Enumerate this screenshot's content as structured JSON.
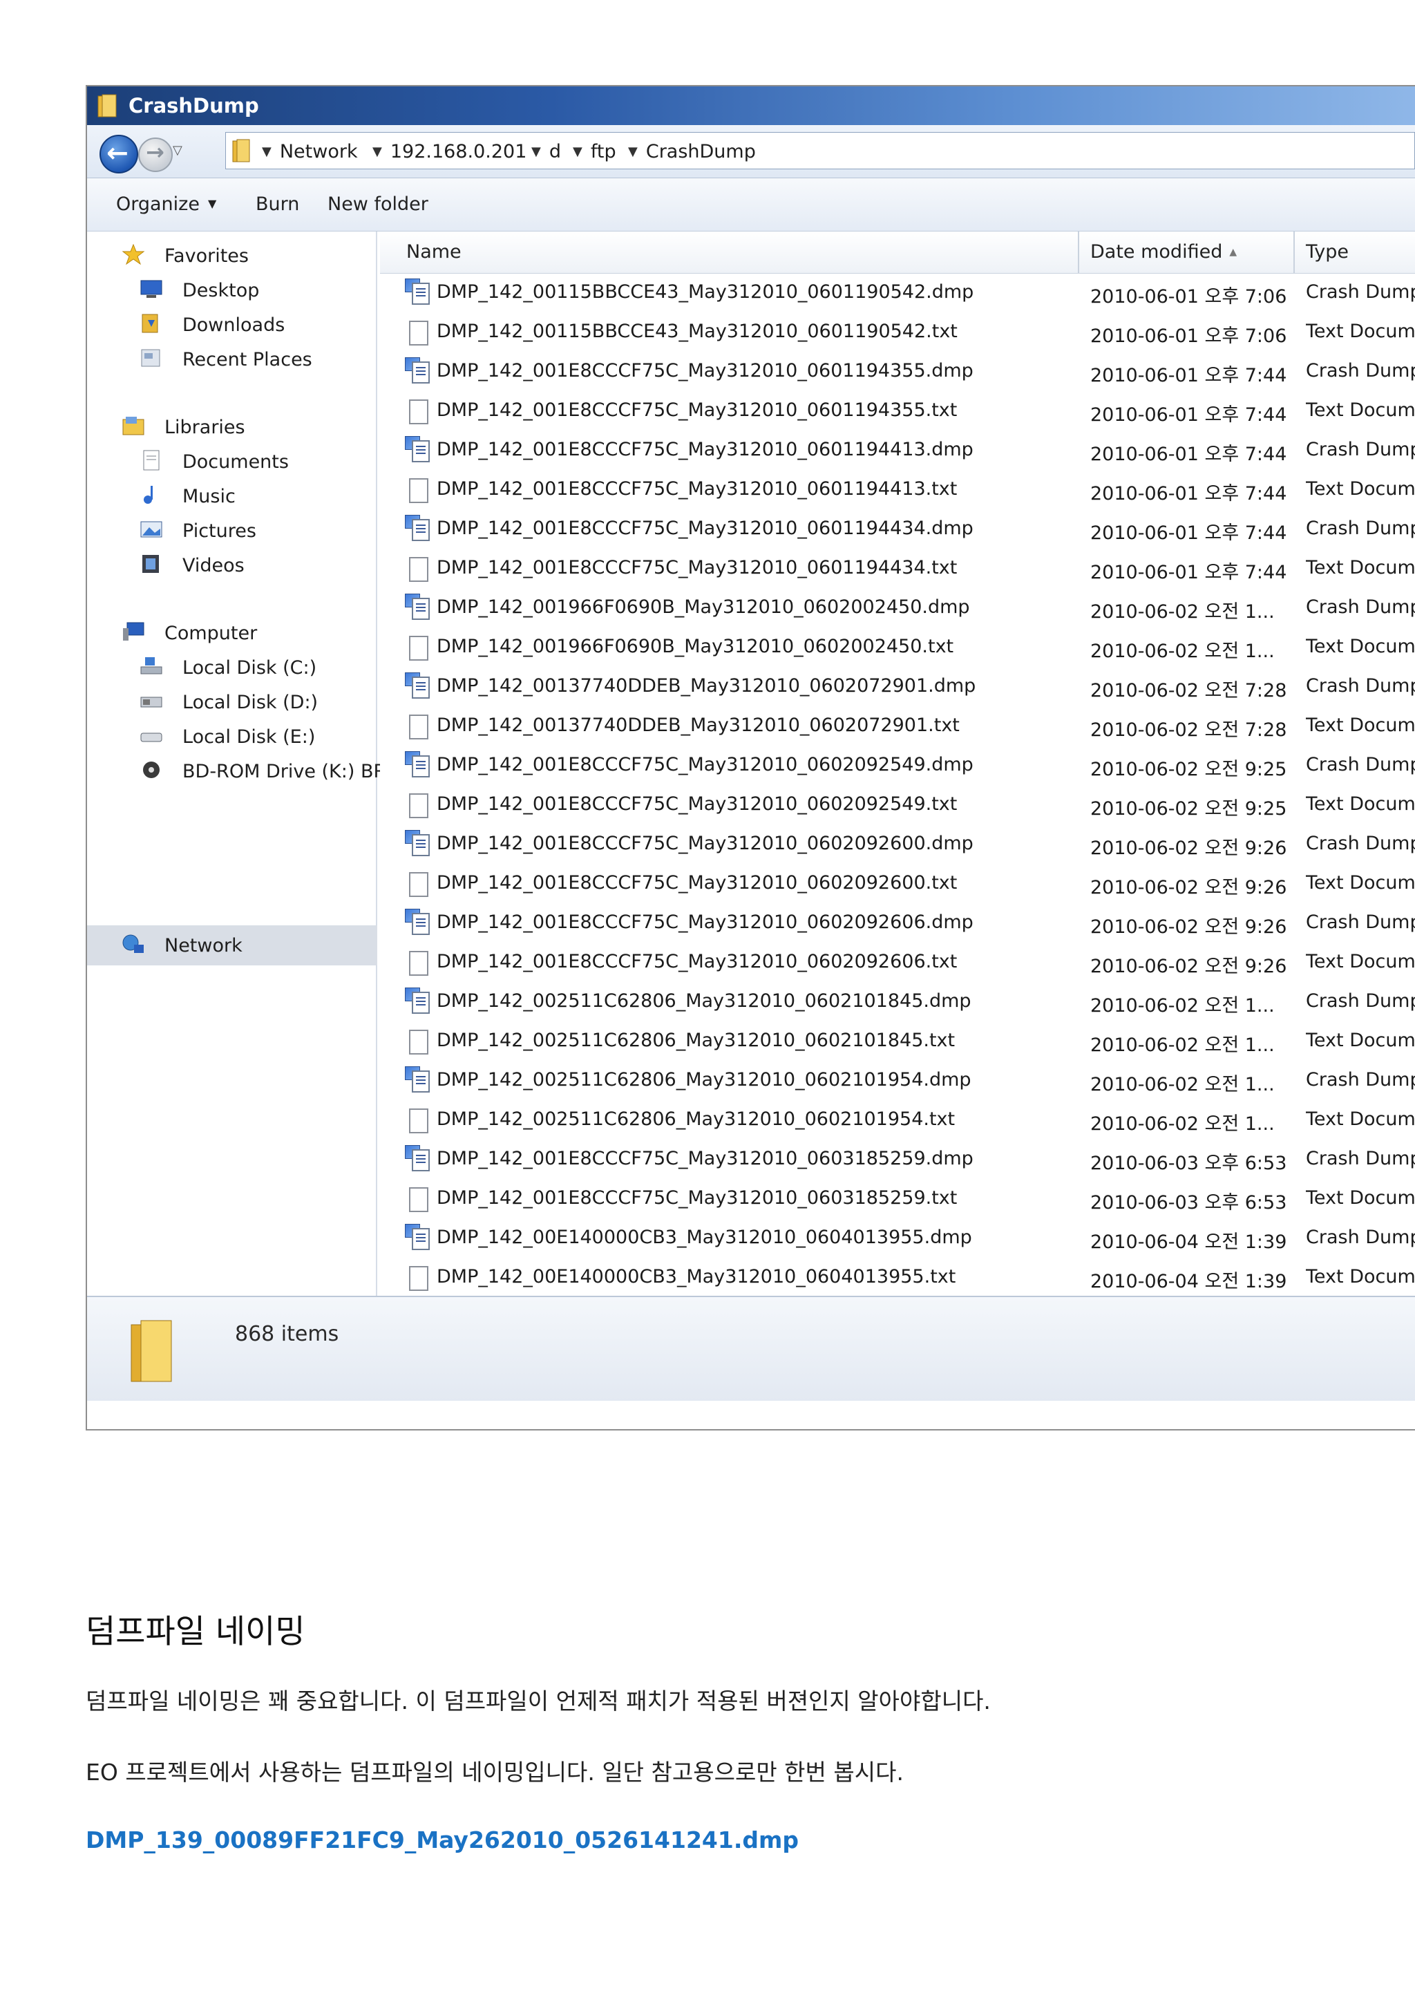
{
  "window": {
    "title": "CrashDump",
    "breadcrumbs": [
      "Network",
      "192.168.0.201",
      "d",
      "ftp",
      "CrashDump"
    ]
  },
  "toolbar": {
    "organize": "Organize",
    "burn": "Burn",
    "new_folder": "New folder"
  },
  "nav": {
    "favorites": "Favorites",
    "desktop": "Desktop",
    "downloads": "Downloads",
    "recent_places": "Recent Places",
    "libraries": "Libraries",
    "documents": "Documents",
    "music": "Music",
    "pictures": "Pictures",
    "videos": "Videos",
    "computer": "Computer",
    "local_c": "Local Disk (C:)",
    "local_d": "Local Disk (D:)",
    "local_e": "Local Disk (E:)",
    "bdrom": "BD-ROM Drive (K:) BR",
    "network": "Network"
  },
  "columns": {
    "name": "Name",
    "date": "Date modified",
    "type": "Type"
  },
  "files": [
    {
      "name": "DMP_142_00115BBCCE43_May312010_0601190542.dmp",
      "date": "2010-06-01 오후 7:06",
      "type": "Crash Dump I",
      "kind": "dmp"
    },
    {
      "name": "DMP_142_00115BBCCE43_May312010_0601190542.txt",
      "date": "2010-06-01 오후 7:06",
      "type": "Text Docume",
      "kind": "txt"
    },
    {
      "name": "DMP_142_001E8CCCF75C_May312010_0601194355.dmp",
      "date": "2010-06-01 오후 7:44",
      "type": "Crash Dump I",
      "kind": "dmp"
    },
    {
      "name": "DMP_142_001E8CCCF75C_May312010_0601194355.txt",
      "date": "2010-06-01 오후 7:44",
      "type": "Text Docume",
      "kind": "txt"
    },
    {
      "name": "DMP_142_001E8CCCF75C_May312010_0601194413.dmp",
      "date": "2010-06-01 오후 7:44",
      "type": "Crash Dump I",
      "kind": "dmp"
    },
    {
      "name": "DMP_142_001E8CCCF75C_May312010_0601194413.txt",
      "date": "2010-06-01 오후 7:44",
      "type": "Text Docume",
      "kind": "txt"
    },
    {
      "name": "DMP_142_001E8CCCF75C_May312010_0601194434.dmp",
      "date": "2010-06-01 오후 7:44",
      "type": "Crash Dump I",
      "kind": "dmp"
    },
    {
      "name": "DMP_142_001E8CCCF75C_May312010_0601194434.txt",
      "date": "2010-06-01 오후 7:44",
      "type": "Text Docume",
      "kind": "txt"
    },
    {
      "name": "DMP_142_001966F0690B_May312010_0602002450.dmp",
      "date": "2010-06-02 오전 1...",
      "type": "Crash Dump I",
      "kind": "dmp"
    },
    {
      "name": "DMP_142_001966F0690B_May312010_0602002450.txt",
      "date": "2010-06-02 오전 1...",
      "type": "Text Docume",
      "kind": "txt"
    },
    {
      "name": "DMP_142_00137740DDEB_May312010_0602072901.dmp",
      "date": "2010-06-02 오전 7:28",
      "type": "Crash Dump I",
      "kind": "dmp"
    },
    {
      "name": "DMP_142_00137740DDEB_May312010_0602072901.txt",
      "date": "2010-06-02 오전 7:28",
      "type": "Text Docume",
      "kind": "txt"
    },
    {
      "name": "DMP_142_001E8CCCF75C_May312010_0602092549.dmp",
      "date": "2010-06-02 오전 9:25",
      "type": "Crash Dump I",
      "kind": "dmp"
    },
    {
      "name": "DMP_142_001E8CCCF75C_May312010_0602092549.txt",
      "date": "2010-06-02 오전 9:25",
      "type": "Text Docume",
      "kind": "txt"
    },
    {
      "name": "DMP_142_001E8CCCF75C_May312010_0602092600.dmp",
      "date": "2010-06-02 오전 9:26",
      "type": "Crash Dump I",
      "kind": "dmp"
    },
    {
      "name": "DMP_142_001E8CCCF75C_May312010_0602092600.txt",
      "date": "2010-06-02 오전 9:26",
      "type": "Text Docume",
      "kind": "txt"
    },
    {
      "name": "DMP_142_001E8CCCF75C_May312010_0602092606.dmp",
      "date": "2010-06-02 오전 9:26",
      "type": "Crash Dump I",
      "kind": "dmp"
    },
    {
      "name": "DMP_142_001E8CCCF75C_May312010_0602092606.txt",
      "date": "2010-06-02 오전 9:26",
      "type": "Text Docume",
      "kind": "txt"
    },
    {
      "name": "DMP_142_002511C62806_May312010_0602101845.dmp",
      "date": "2010-06-02 오전 1...",
      "type": "Crash Dump I",
      "kind": "dmp"
    },
    {
      "name": "DMP_142_002511C62806_May312010_0602101845.txt",
      "date": "2010-06-02 오전 1...",
      "type": "Text Docume",
      "kind": "txt"
    },
    {
      "name": "DMP_142_002511C62806_May312010_0602101954.dmp",
      "date": "2010-06-02 오전 1...",
      "type": "Crash Dump I",
      "kind": "dmp"
    },
    {
      "name": "DMP_142_002511C62806_May312010_0602101954.txt",
      "date": "2010-06-02 오전 1...",
      "type": "Text Docume",
      "kind": "txt"
    },
    {
      "name": "DMP_142_001E8CCCF75C_May312010_0603185259.dmp",
      "date": "2010-06-03 오후 6:53",
      "type": "Crash Dump I",
      "kind": "dmp"
    },
    {
      "name": "DMP_142_001E8CCCF75C_May312010_0603185259.txt",
      "date": "2010-06-03 오후 6:53",
      "type": "Text Docume",
      "kind": "txt"
    },
    {
      "name": "DMP_142_00E140000CB3_May312010_0604013955.dmp",
      "date": "2010-06-04 오전 1:39",
      "type": "Crash Dump I",
      "kind": "dmp"
    },
    {
      "name": "DMP_142_00E140000CB3_May312010_0604013955.txt",
      "date": "2010-06-04 오전 1:39",
      "type": "Text Docume",
      "kind": "txt"
    }
  ],
  "status": {
    "item_count": "868 items"
  },
  "article": {
    "heading": "덤프파일 네이밍",
    "para1": "덤프파일 네이밍은 꽤 중요합니다. 이 덤프파일이 언제적 패치가 적용된 버젼인지 알아야합니다.",
    "para2": "EO 프로젝트에서 사용하는 덤프파일의 네이밍입니다. 일단 참고용으로만 한번 봅시다.",
    "example_filename": "DMP_139_00089FF21FC9_May262010_0526141241.dmp"
  }
}
